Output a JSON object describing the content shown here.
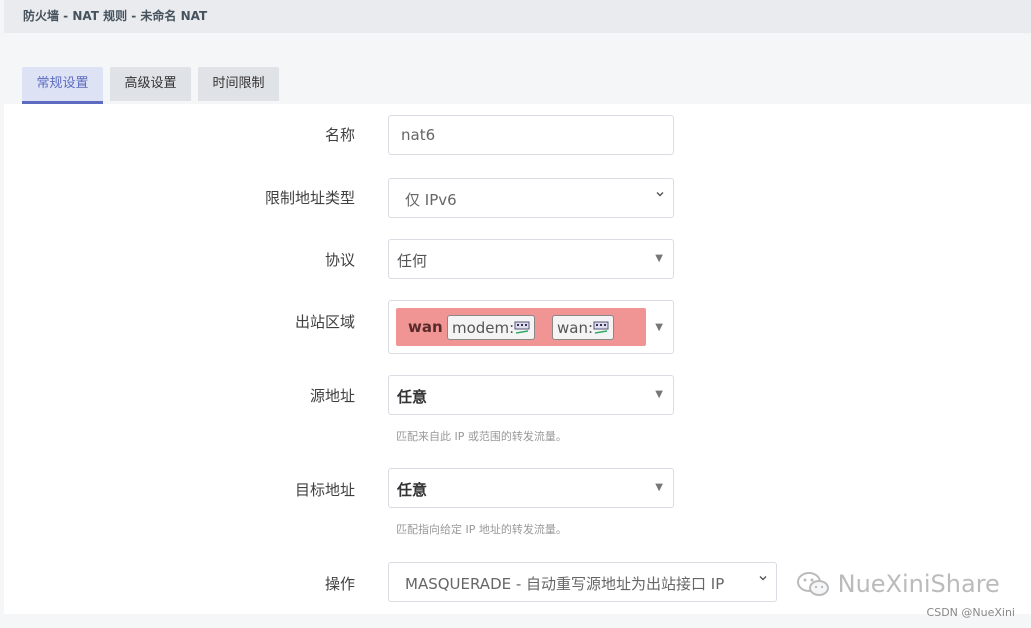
{
  "header": {
    "title": "防火墙 - NAT 规则 - 未命名 NAT"
  },
  "tabs": [
    {
      "label": "常规设置",
      "active": true
    },
    {
      "label": "高级设置",
      "active": false
    },
    {
      "label": "时间限制",
      "active": false
    }
  ],
  "form": {
    "name": {
      "label": "名称",
      "value": "nat6"
    },
    "family": {
      "label": "限制地址类型",
      "value": "仅 IPv6"
    },
    "proto": {
      "label": "协议",
      "value": "任何"
    },
    "zone": {
      "label": "出站区域",
      "zone_name": "wan",
      "interfaces": [
        "modem:",
        "wan:"
      ],
      "zone_color": "#f09494"
    },
    "src": {
      "label": "源地址",
      "value": "任意",
      "hint": "匹配来自此 IP 或范围的转发流量。"
    },
    "dest": {
      "label": "目标地址",
      "value": "任意",
      "hint": "匹配指向给定 IP 地址的转发流量。"
    },
    "target": {
      "label": "操作",
      "value": "MASQUERADE - 自动重写源地址为出站接口 IP"
    }
  },
  "watermark": {
    "text": "NueXiniShare",
    "credit": "CSDN @NueXini"
  },
  "colors": {
    "accent": "#5c6bc0",
    "header_bg": "#e9ebee",
    "panel_bg": "#ffffff"
  }
}
